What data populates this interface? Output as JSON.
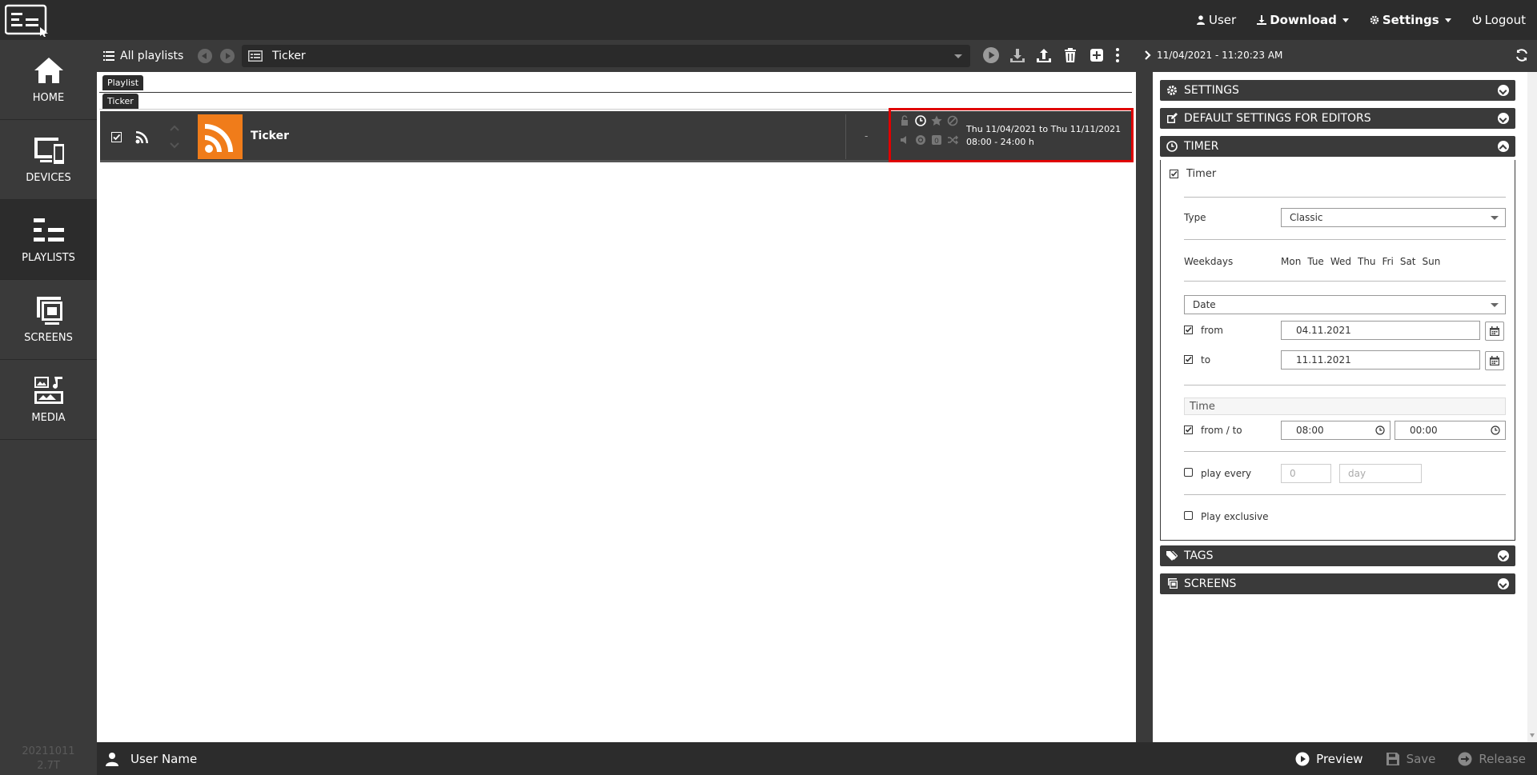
{
  "topnav": {
    "user": "User",
    "download": "Download",
    "settings": "Settings",
    "logout": "Logout"
  },
  "sidebar": {
    "items": [
      {
        "label": "HOME",
        "icon": "home-icon"
      },
      {
        "label": "DEVICES",
        "icon": "devices-icon"
      },
      {
        "label": "PLAYLISTS",
        "icon": "playlists-icon",
        "active": true
      },
      {
        "label": "SCREENS",
        "icon": "screens-icon"
      },
      {
        "label": "MEDIA",
        "icon": "media-icon"
      }
    ],
    "version_line1": "20211011",
    "version_line2": "2.7T"
  },
  "toolbar": {
    "all_playlists": "All playlists",
    "selected_playlist": "Ticker"
  },
  "tabs": {
    "playlist": "Playlist",
    "ticker": "Ticker"
  },
  "row": {
    "name": "Ticker",
    "dash": "-",
    "date_range": "Thu 11/04/2021 to Thu 11/11/2021",
    "time_range": "08:00 - 24:00 h",
    "thumb_color": "#f07c1a",
    "highlight_color": "#e00000"
  },
  "panel": {
    "datetime": "11/04/2021 - 11:20:23 AM",
    "sections": {
      "settings": "SETTINGS",
      "default_settings": "DEFAULT SETTINGS FOR EDITORS",
      "timer": "TIMER",
      "tags": "TAGS",
      "screens": "SCREENS"
    },
    "timer": {
      "enable_label": "Timer",
      "type_label": "Type",
      "type_value": "Classic",
      "weekdays_label": "Weekdays",
      "weekdays": [
        "Mon",
        "Tue",
        "Wed",
        "Thu",
        "Fri",
        "Sat",
        "Sun"
      ],
      "mode_value": "Date",
      "from_label": "from",
      "from_value": "04.11.2021",
      "to_label": "to",
      "to_value": "11.11.2021",
      "time_section": "Time",
      "fromto_label": "from / to",
      "time_from": "08:00",
      "time_to": "00:00",
      "play_every_label": "play every",
      "play_every_value": "0",
      "play_every_unit": "day",
      "play_exclusive_label": "Play exclusive"
    }
  },
  "footer": {
    "user_name": "User Name",
    "preview": "Preview",
    "save": "Save",
    "release": "Release"
  }
}
